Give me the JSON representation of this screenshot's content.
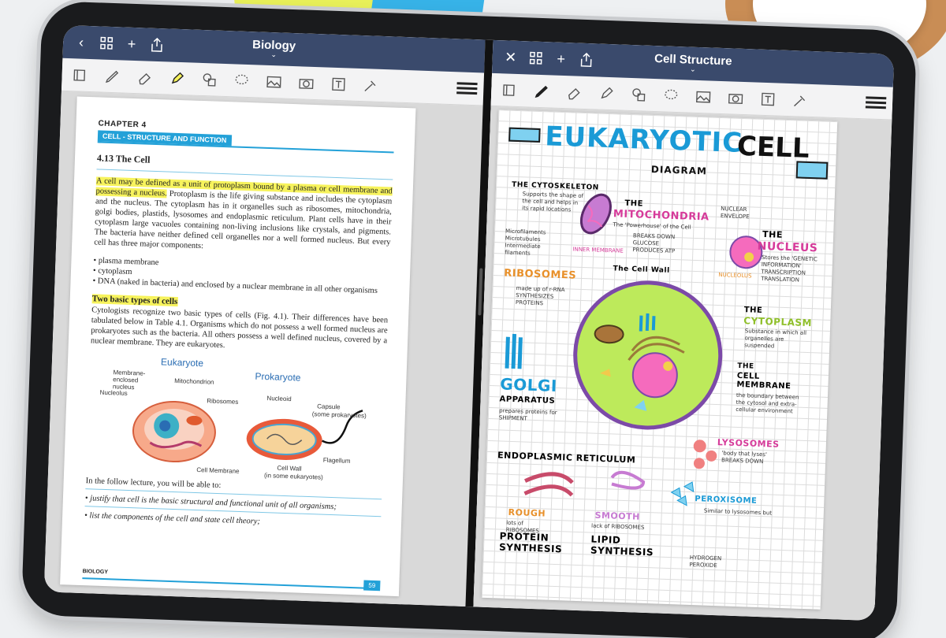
{
  "left_pane": {
    "title": "Biology",
    "document": {
      "chapter": "CHAPTER 4",
      "chapter_subtitle": "CELL - STRUCTURE AND FUNCTION",
      "section": "4.13  The Cell",
      "para1_highlight": "A cell may be defined as a unit of protoplasm bound by a plasma or cell membrane and possessing a nucleus.",
      "para1_rest": " Protoplasm is the life giving substance and includes the cytoplasm and the nucleus. The cytoplasm has in it organelles such as ribosomes, mitochondria, golgi bodies, plastids, lysosomes and endoplasmic reticulum. Plant cells have in their cytoplasm large vacuoles containing non-living inclusions like crystals, and pigments. The bacteria have neither defined cell organelles nor a well formed nucleus. But every cell has three major components:",
      "bullets": [
        "plasma membrane",
        "cytoplasm",
        "DNA (naked in bacteria) and enclosed by a nuclear membrane in all other organisms"
      ],
      "subhead": "Two basic types of cells",
      "para2": "Cytologists recognize two basic types of cells (Fig. 4.1). Their differences have been tabulated below in Table 4.1. Organisms which do not possess a well formed nucleus are prokaryotes such as the bacteria. All others possess a well defined nucleus, covered by a nuclear membrane. They are eukaryotes.",
      "figure": {
        "eukaryote": "Eukaryote",
        "prokaryote": "Prokaryote",
        "membrane_nucleus": "Membrane-enclosed nucleus",
        "mitochondrion": "Mitochondrion",
        "nucleolus": "Nucleolus",
        "ribosomes": "Ribosomes",
        "nucleoid": "Nucleoid",
        "capsule": "Capsule",
        "capsule_note": "(some prokaryotes)",
        "cell_membrane": "Cell Membrane",
        "cell_wall": "Cell Wall",
        "cell_wall_note": "(in some eukaryotes)",
        "flagellum": "Flagellum"
      },
      "lecture_intro": "In the follow lecture, you will be able to:",
      "lecture_items": [
        "justify that cell is the basic structural and functional unit of all organisms;",
        "list the components of the cell and state cell theory;"
      ],
      "footer": "BIOLOGY",
      "page_number": "59"
    }
  },
  "right_pane": {
    "title": "Cell Structure",
    "note": {
      "title1": "EUKARYOTIC",
      "title2": "CELL",
      "subtitle": "DIAGRAM",
      "cytoskeleton": "THE CYTOSKELETON",
      "cytoskeleton_note": "Supports the shape of the cell and helps in its rapid locations",
      "cytoskeleton_list": "Microfilaments Microtubules Intermediate filaments",
      "mitochondria_the": "THE",
      "mitochondria": "MITOCHONDRIA",
      "mitochondria_note": "The 'Powerhouse' of the Cell",
      "mitochondria_breaks": "BREAKS DOWN GLUCOSE PRODUCES ATP",
      "inner_membrane": "INNER MEMBRANE",
      "nucleus_the": "THE",
      "nucleus": "NUCLEUS",
      "nucleus_note": "Stores the 'GENETIC INFORMATION' TRANSCRIPTION TRANSLATION",
      "nuclear_envelope": "NUCLEAR ENVELOPE",
      "nucleolus": "NUCLEOLUS",
      "ribosomes": "RIBOSOMES",
      "ribosomes_note": "made up of r-RNA SYNTHESIZES PROTEINS",
      "cell_wall": "The Cell Wall",
      "cytoplasm_the": "THE",
      "cytoplasm": "CYTOPLASM",
      "cytoplasm_note": "Substance in which all organelles are suspended",
      "golgi": "GOLGI",
      "golgi_app": "APPARATUS",
      "golgi_note": "prepares proteins for SHIPMENT",
      "cell_membrane_the": "THE",
      "cell_membrane": "CELL MEMBRANE",
      "cell_membrane_note": "the boundary between the cytosol and extra-cellular environment",
      "lysosomes": "LYSOSOMES",
      "lysosomes_note": "'body that lyses' BREAKS DOWN",
      "er": "ENDOPLASMIC RETICULUM",
      "rough": "ROUGH",
      "rough_note": "lots of RIBOSOMES",
      "rough_out": "PROTEIN SYNTHESIS",
      "smooth": "SMOOTH",
      "smooth_note": "lack of RIBOSOMES",
      "smooth_out": "LIPID SYNTHESIS",
      "peroxisome": "PEROXISOME",
      "peroxisome_note": "Similar to lysosomes but",
      "hydrogen": "HYDROGEN PEROXIDE"
    }
  },
  "colors": {
    "titlebar": "#3a4a6c",
    "accent_blue": "#23a1d8",
    "highlight": "#f7f35c",
    "note_pink": "#d63b9a",
    "note_orange": "#e8902a",
    "note_blue": "#1a9ad6"
  },
  "icons": [
    "back-icon",
    "grid-icon",
    "plus-icon",
    "share-icon",
    "close-icon",
    "undo-icon",
    "more-icon",
    "pen-icon",
    "eraser-icon",
    "highlighter-icon",
    "shapes-icon",
    "lasso-icon",
    "image-icon",
    "camera-icon",
    "text-icon",
    "laser-icon",
    "bluetooth-icon",
    "pages-icon"
  ]
}
